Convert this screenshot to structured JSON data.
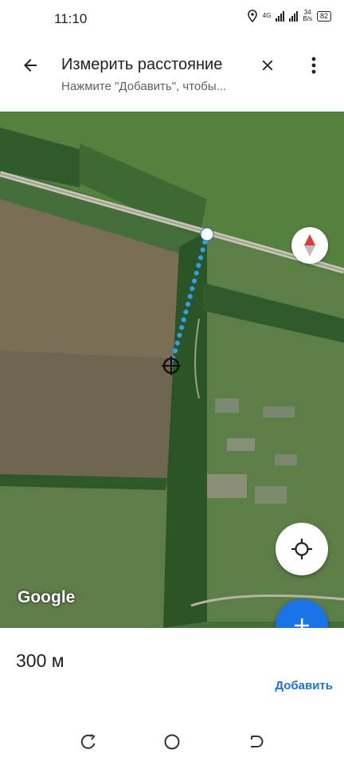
{
  "status_bar": {
    "time": "11:10",
    "network_type": "4G",
    "speed_value": "34",
    "speed_unit": "B/s",
    "battery": "82"
  },
  "app_bar": {
    "title": "Измерить расстояние",
    "subtitle": "Нажмите \"Добавить\", чтобы..."
  },
  "map": {
    "logo": "Google"
  },
  "measurement": {
    "distance": "300 м",
    "add_label": "Добавить"
  },
  "colors": {
    "accent": "#1a73e8",
    "measure_line": "#29a3f0",
    "compass_red": "#e53935"
  },
  "icons": [
    "back-arrow-icon",
    "close-icon",
    "more-vert-icon",
    "compass-icon",
    "my-location-icon",
    "plus-icon",
    "recents-icon",
    "home-icon",
    "back-icon",
    "location-icon"
  ]
}
